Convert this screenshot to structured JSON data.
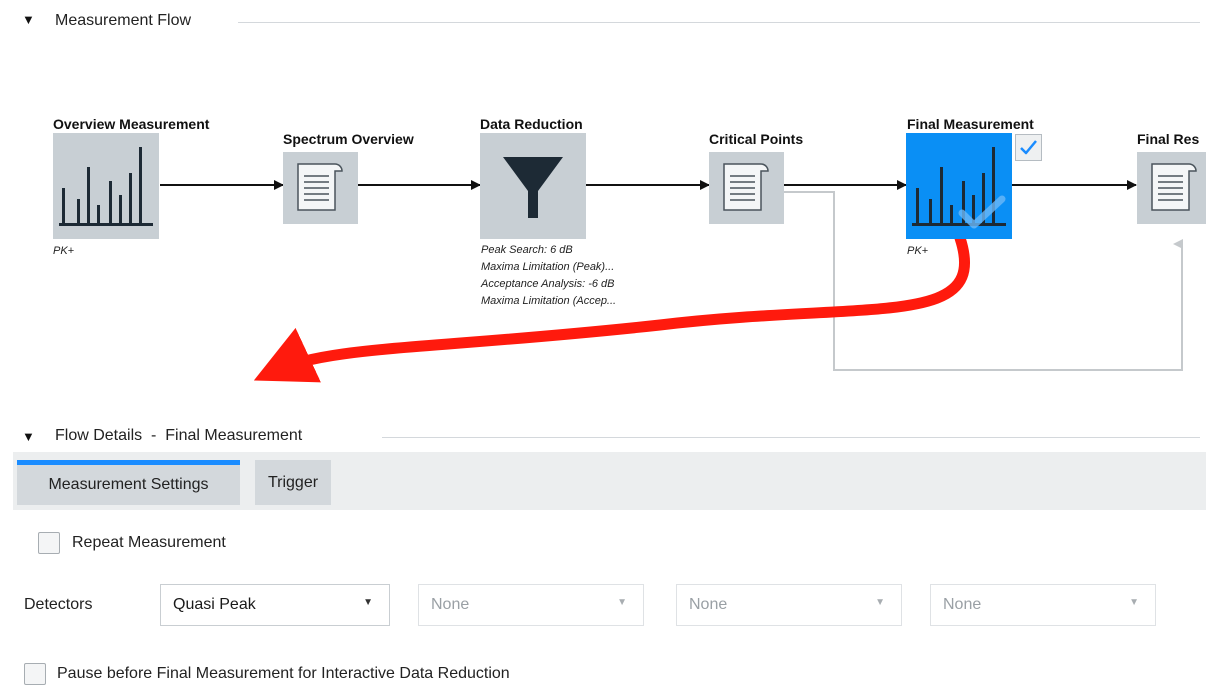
{
  "flow": {
    "title": "Measurement Flow",
    "nodes": {
      "overview": {
        "label": "Overview Measurement",
        "note": "PK+"
      },
      "spectrum": {
        "label": "Spectrum Overview"
      },
      "reduction": {
        "label": "Data Reduction",
        "notes": [
          "Peak Search: 6 dB",
          "Maxima Limitation (Peak)...",
          "Acceptance Analysis: -6 dB",
          "Maxima Limitation (Accep..."
        ]
      },
      "critical": {
        "label": "Critical Points"
      },
      "final": {
        "label": "Final Measurement",
        "note": "PK+",
        "checked": true
      },
      "results": {
        "label": "Final Res"
      }
    }
  },
  "details": {
    "title": "Flow Details",
    "separator": "-",
    "subtitle": "Final Measurement",
    "tabs": [
      "Measurement Settings",
      "Trigger"
    ],
    "repeat_label": "Repeat Measurement",
    "detectors_label": "Detectors",
    "detectors": [
      "Quasi Peak",
      "None",
      "None",
      "None"
    ],
    "pause_label": "Pause before Final Measurement for Interactive Data Reduction"
  },
  "colors": {
    "accent": "#1a8cff",
    "final_node": "#0a8ff5",
    "node": "#c8cfd4",
    "annotation_arrow": "#ff1a0d"
  }
}
